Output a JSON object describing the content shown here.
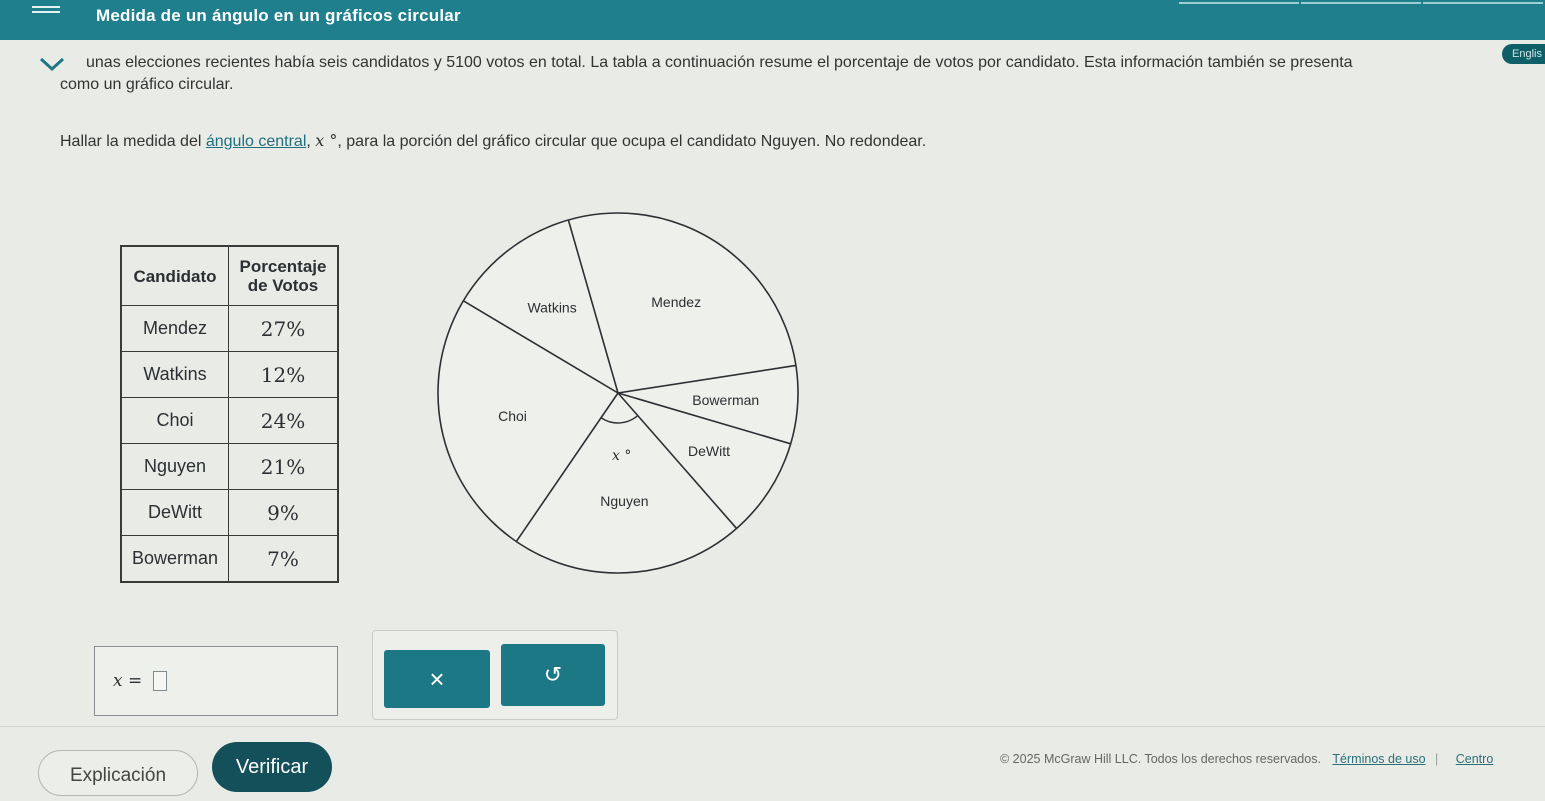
{
  "header": {
    "title": "Medida de un ángulo en un gráficos circular"
  },
  "language_toggle": "Englis",
  "problem": {
    "line1": "unas elecciones recientes había seis candidatos y 5100 votos en total. La tabla a continuación resume el porcentaje de votos por candidato. Esta información también se presenta",
    "line2": "como un gráfico circular.",
    "question_pre": "Hallar la medida del ",
    "question_link": "ángulo central",
    "question_var": "x °",
    "question_post": ", para la porción del gráfico circular que ocupa el candidato Nguyen. No redondear."
  },
  "table": {
    "headers": [
      "Candidato",
      "Porcentaje de Votos"
    ],
    "rows": [
      {
        "name": "Mendez",
        "pct": "27%"
      },
      {
        "name": "Watkins",
        "pct": "12%"
      },
      {
        "name": "Choi",
        "pct": "24%"
      },
      {
        "name": "Nguyen",
        "pct": "21%"
      },
      {
        "name": "DeWitt",
        "pct": "9%"
      },
      {
        "name": "Bowerman",
        "pct": "7%"
      }
    ]
  },
  "chart_data": {
    "type": "pie",
    "slices": [
      {
        "label": "Mendez",
        "value": 27
      },
      {
        "label": "Bowerman",
        "value": 7
      },
      {
        "label": "DeWitt",
        "value": 9
      },
      {
        "label": "Nguyen",
        "value": 21
      },
      {
        "label": "Choi",
        "value": 24
      },
      {
        "label": "Watkins",
        "value": 12
      }
    ],
    "angle_label": "x °",
    "title": ""
  },
  "answer": {
    "label": "x =",
    "value": ""
  },
  "tools": {
    "clear_symbol": "×",
    "undo_symbol": "↺"
  },
  "actions": {
    "explain_label": "Explicación",
    "check_label": "Verificar"
  },
  "footer": {
    "copyright": "© 2025 McGraw Hill LLC. Todos los derechos reservados.",
    "terms": "Términos de uso",
    "center": "Centro"
  }
}
